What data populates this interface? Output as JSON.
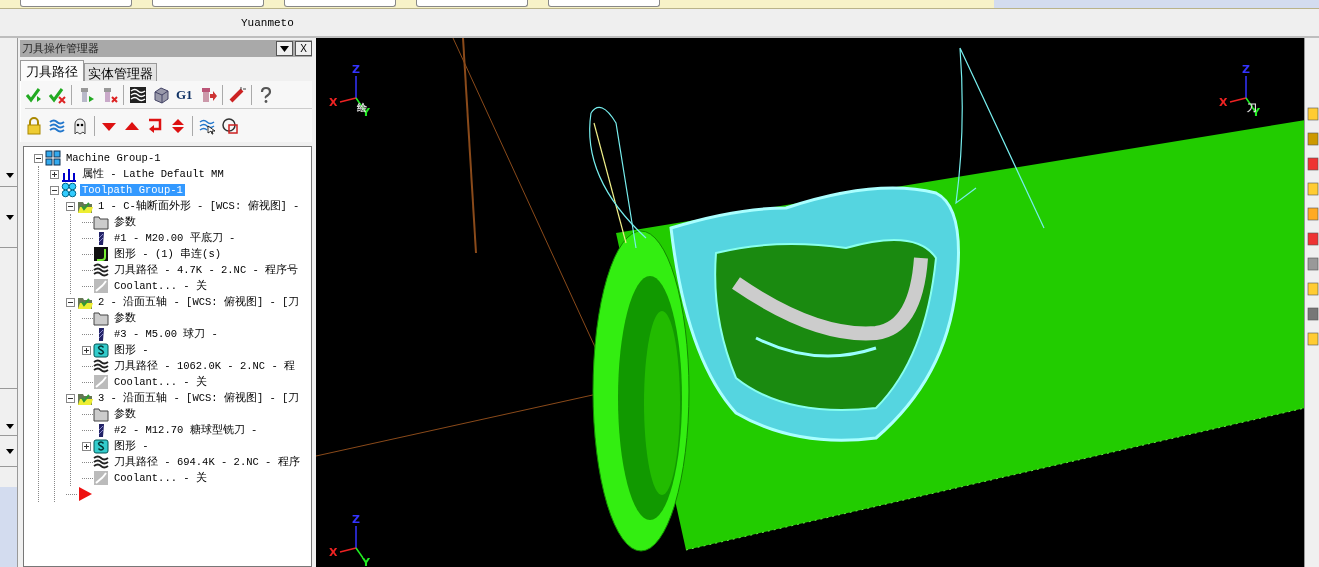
{
  "app_title": "Yuanmeto",
  "panel": {
    "title": "刀具操作管理器",
    "close_label": "X",
    "tabs": [
      {
        "label": "刀具路径",
        "selected": true
      },
      {
        "label": "实体管理器",
        "selected": false
      }
    ],
    "toolbar_rows": [
      [
        {
          "kind": "check"
        },
        {
          "kind": "check-x"
        },
        {
          "kind": "sep"
        },
        {
          "kind": "tool-play"
        },
        {
          "kind": "tool-x"
        },
        {
          "kind": "sep"
        },
        {
          "kind": "waves"
        },
        {
          "kind": "cube"
        },
        {
          "kind": "text",
          "text": "G1"
        },
        {
          "kind": "tool-arrow"
        },
        {
          "kind": "sep"
        },
        {
          "kind": "wand"
        },
        {
          "kind": "sep"
        },
        {
          "kind": "help"
        }
      ],
      [
        {
          "kind": "lock"
        },
        {
          "kind": "waves-blue"
        },
        {
          "kind": "ghost"
        },
        {
          "kind": "sep"
        },
        {
          "kind": "down"
        },
        {
          "kind": "up"
        },
        {
          "kind": "loop"
        },
        {
          "kind": "updown"
        },
        {
          "kind": "sep"
        },
        {
          "kind": "waves-cursor"
        },
        {
          "kind": "circles"
        }
      ]
    ],
    "tree": [
      {
        "label": "Machine Group-1",
        "kind": "machine",
        "expanded": true,
        "selected": false,
        "children": [
          {
            "label": "属性 - Lathe Default MM",
            "kind": "props",
            "expanded": false,
            "selected": false
          },
          {
            "label": "Toolpath Group-1",
            "kind": "group",
            "expanded": true,
            "selected": true,
            "children": [
              {
                "label": "1 - C-轴断面外形 - [WCS: 俯视图] -",
                "kind": "op",
                "expanded": true,
                "selected": false,
                "children": [
                  {
                    "label": "参数",
                    "kind": "folder",
                    "selected": false
                  },
                  {
                    "label": "#1 - M20.00 平底刀 -",
                    "kind": "tool",
                    "selected": false
                  },
                  {
                    "label": "图形 - (1) 串连(s)",
                    "kind": "geometry",
                    "selected": false
                  },
                  {
                    "label": "刀具路径 - 4.7K - 2.NC - 程序号",
                    "kind": "toolpath",
                    "selected": false
                  },
                  {
                    "label": "Coolant... - 关",
                    "kind": "coolant",
                    "selected": false
                  }
                ]
              },
              {
                "label": "2 - 沿面五轴 - [WCS: 俯视图] - [刀",
                "kind": "op",
                "expanded": true,
                "selected": false,
                "children": [
                  {
                    "label": "参数",
                    "kind": "folder",
                    "selected": false
                  },
                  {
                    "label": "#3 - M5.00 球刀 -",
                    "kind": "tool",
                    "selected": false
                  },
                  {
                    "label": "图形 -",
                    "kind": "surface",
                    "expanded": false,
                    "selected": false
                  },
                  {
                    "label": "刀具路径 - 1062.0K - 2.NC - 程",
                    "kind": "toolpath",
                    "selected": false
                  },
                  {
                    "label": "Coolant... - 关",
                    "kind": "coolant",
                    "selected": false
                  }
                ]
              },
              {
                "label": "3 - 沿面五轴 - [WCS: 俯视图] - [刀",
                "kind": "op",
                "expanded": true,
                "selected": false,
                "children": [
                  {
                    "label": "参数",
                    "kind": "folder",
                    "selected": false
                  },
                  {
                    "label": "#2 - M12.70 糖球型铣刀 -",
                    "kind": "tool",
                    "selected": false
                  },
                  {
                    "label": "图形 -",
                    "kind": "surface",
                    "expanded": false,
                    "selected": false
                  },
                  {
                    "label": "刀具路径 - 694.4K - 2.NC - 程序",
                    "kind": "toolpath",
                    "selected": false
                  },
                  {
                    "label": "Coolant... - 关",
                    "kind": "coolant",
                    "selected": false
                  }
                ]
              },
              {
                "kind": "insert",
                "selected": false
              }
            ]
          }
        ]
      }
    ]
  },
  "viewport": {
    "triads": [
      {
        "x": "X",
        "y": "Y",
        "z": "Z",
        "plane": "绘"
      },
      {
        "x": "X",
        "y": "Y",
        "z": "Z",
        "plane": "刀"
      },
      {
        "x": "X",
        "y": "Y",
        "z": "Z"
      }
    ]
  }
}
